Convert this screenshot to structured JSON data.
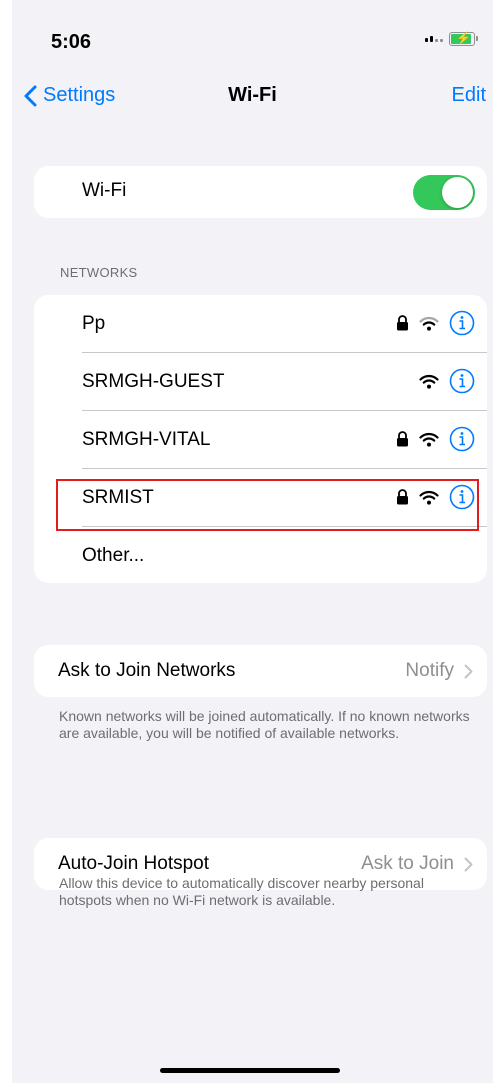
{
  "status_bar": {
    "time": "5:06"
  },
  "nav": {
    "back_label": "Settings",
    "title": "Wi-Fi",
    "edit_label": "Edit"
  },
  "wifi": {
    "label": "Wi-Fi",
    "enabled": true
  },
  "networks_header": "NETWORKS",
  "networks": [
    {
      "name": "Pp",
      "secured": true,
      "icons": [
        "lock-icon",
        "wifi-signal-icon",
        "info-icon"
      ]
    },
    {
      "name": "SRMGH-GUEST",
      "secured": false,
      "icons": [
        "wifi-signal-icon",
        "info-icon"
      ]
    },
    {
      "name": "SRMGH-VITAL",
      "secured": true,
      "icons": [
        "lock-icon",
        "wifi-signal-icon",
        "info-icon"
      ]
    },
    {
      "name": "SRMIST",
      "secured": true,
      "icons": [
        "lock-icon",
        "wifi-signal-icon",
        "info-icon"
      ],
      "highlighted": true
    },
    {
      "name": "Other..."
    }
  ],
  "ask_to_join": {
    "label": "Ask to Join Networks",
    "value": "Notify",
    "note": "Known networks will be joined automatically. If no known networks are available, you will be notified of available networks."
  },
  "auto_join_hotspot": {
    "label": "Auto-Join Hotspot",
    "value": "Ask to Join",
    "note": "Allow this device to automatically discover nearby personal hotspots when no Wi-Fi network is available."
  },
  "colors": {
    "accent": "#007aff",
    "toggle_on": "#34c759",
    "highlight": "#e31d1d",
    "background": "#f2f2f7"
  }
}
